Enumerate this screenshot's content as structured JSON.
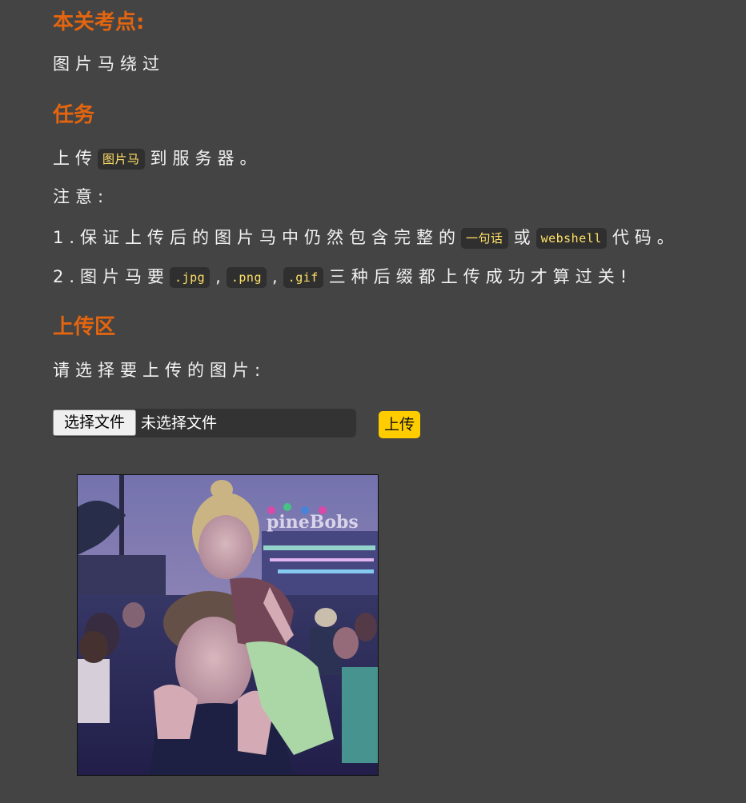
{
  "sections": {
    "checkpoint": {
      "title": "本关考点:",
      "text": "图片马绕过"
    },
    "task": {
      "title": "任务",
      "line1_before": "上传",
      "line1_code": "图片马",
      "line1_after": "到服务器。",
      "note_label": "注意:",
      "item1_before": "1.保证上传后的图片马中仍然包含完整的",
      "item1_code1": "一句话",
      "item1_mid": "或",
      "item1_code2": "webshell",
      "item1_after": "代码。",
      "item2_before": "2.图片马要",
      "item2_code1": ".jpg",
      "item2_sep1": ",",
      "item2_code2": ".png",
      "item2_sep2": ",",
      "item2_code3": ".gif",
      "item2_after": "三种后缀都上传成功才算过关!"
    },
    "upload": {
      "title": "上传区",
      "prompt": "请选择要上传的图片:",
      "choose_button": "选择文件",
      "file_status": "未选择文件",
      "submit_button": "上传"
    }
  },
  "preview": {
    "sign_text": "pineBobs"
  },
  "colors": {
    "background": "#444444",
    "heading": "#e3650f",
    "code_text": "#ffe066",
    "code_bg": "#2f2f2f",
    "submit_bg": "#ffcc00"
  }
}
